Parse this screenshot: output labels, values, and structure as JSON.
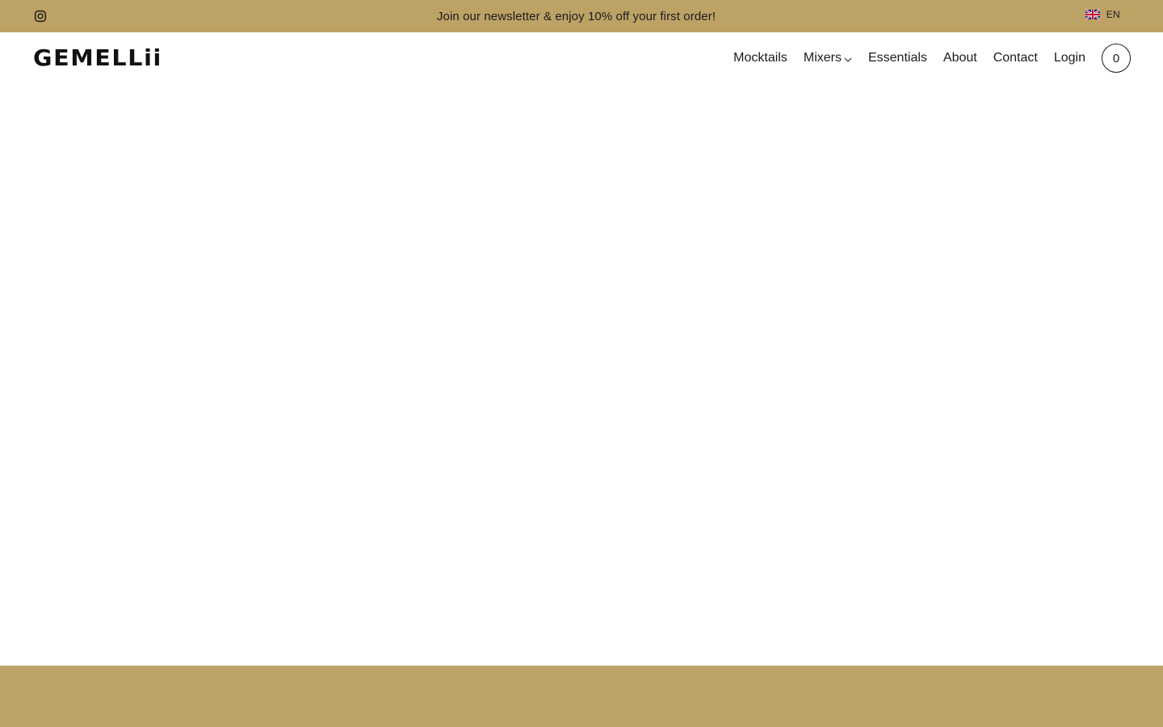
{
  "announcement": {
    "text": "Join our newsletter & enjoy 10% off your first order!",
    "social_icon": "instagram-icon",
    "language": {
      "flag_icon": "uk-flag-icon",
      "label": "EN"
    }
  },
  "header": {
    "logo": "GEMELLii",
    "nav": [
      {
        "label": "Mocktails"
      },
      {
        "label": "Mixers",
        "has_dropdown": true,
        "dropdown_icon": "chevron-down-icon"
      },
      {
        "label": "Essentials"
      },
      {
        "label": "About"
      },
      {
        "label": "Contact"
      },
      {
        "label": "Login"
      }
    ],
    "cart_count": "0"
  },
  "colors": {
    "brand_gold": "#BDA266",
    "text_dark": "#1c1c1c",
    "background": "#ffffff"
  }
}
